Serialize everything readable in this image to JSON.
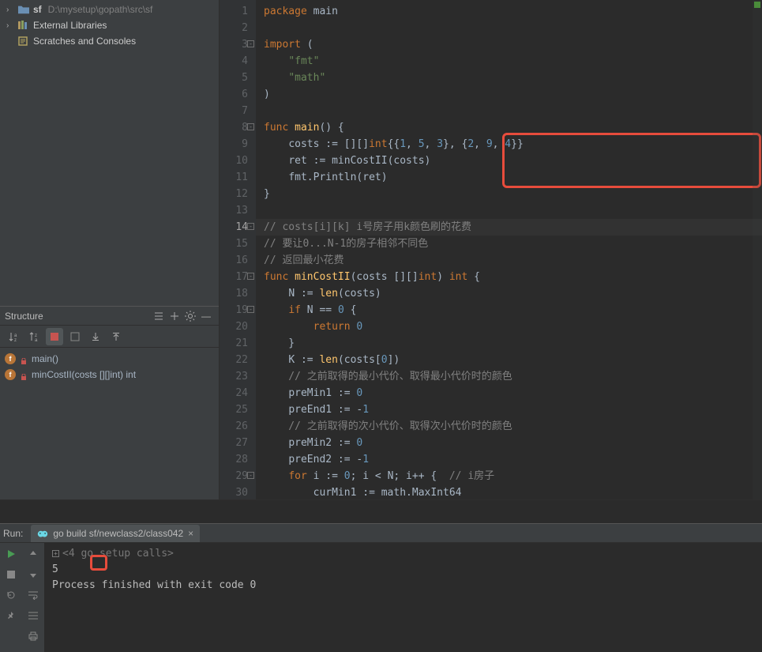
{
  "project": {
    "root_name": "sf",
    "root_path": "D:\\mysetup\\gopath\\src\\sf",
    "external_libs": "External Libraries",
    "scratches": "Scratches and Consoles"
  },
  "structure": {
    "title": "Structure",
    "items": [
      {
        "label": "main()"
      },
      {
        "label": "minCostII(costs [][]int) int"
      }
    ]
  },
  "editor": {
    "current_line": 14,
    "lines": [
      {
        "n": 1,
        "kw": "package ",
        "rest": "main"
      },
      {
        "n": 2,
        "plain": ""
      },
      {
        "n": 3,
        "kw": "import ",
        "rest": "(",
        "fold": "-"
      },
      {
        "n": 4,
        "indent": "    ",
        "str": "\"fmt\""
      },
      {
        "n": 5,
        "indent": "    ",
        "str": "\"math\""
      },
      {
        "n": 6,
        "plain": ")",
        "foldclose": true
      },
      {
        "n": 7,
        "plain": ""
      },
      {
        "n": 8,
        "funcline": true,
        "fold": "-"
      },
      {
        "n": 9,
        "costs": true
      },
      {
        "n": 10,
        "ret": true
      },
      {
        "n": 11,
        "println": true
      },
      {
        "n": 12,
        "plain": "}",
        "foldclose": true
      },
      {
        "n": 13,
        "plain": ""
      },
      {
        "n": 14,
        "cmt": "// costs[i][k] i号房子用k颜色刷的花费",
        "fold": "-"
      },
      {
        "n": 15,
        "cmt": "// 要让0...N-1的房子相邻不同色"
      },
      {
        "n": 16,
        "cmt": "// 返回最小花费",
        "foldclose": true
      },
      {
        "n": 17,
        "mincost_sig": true,
        "fold": "-"
      },
      {
        "n": 18,
        "nlen": true
      },
      {
        "n": 19,
        "ifn": true,
        "fold": "-"
      },
      {
        "n": 20,
        "ret0": true
      },
      {
        "n": 21,
        "plain": "    }",
        "foldclose": true
      },
      {
        "n": 22,
        "klen": true
      },
      {
        "n": 23,
        "cmt": "    // 之前取得的最小代价、取得最小代价时的颜色"
      },
      {
        "n": 24,
        "premin1": true
      },
      {
        "n": 25,
        "preend1": true
      },
      {
        "n": 26,
        "cmt": "    // 之前取得的次小代价、取得次小代价时的颜色"
      },
      {
        "n": 27,
        "premin2": true
      },
      {
        "n": 28,
        "preend2": true
      },
      {
        "n": 29,
        "forloop": true,
        "fold": "-"
      },
      {
        "n": 30,
        "curmin": true
      }
    ]
  },
  "run": {
    "label": "Run:",
    "tab_title": "go build sf/newclass2/class042",
    "setup_calls": "<4 go setup calls>",
    "output": "5",
    "exit_msg": "Process finished with exit code 0"
  },
  "code_tokens": {
    "func": "func",
    "main": "main",
    "costs": "costs",
    "assign": " := ",
    "int2d": "[][]",
    "int_kw": "int",
    "open": "{{",
    "c1": "1",
    "c2": "5",
    "c3": "3",
    "c4": "2",
    "c5": "9",
    "c6": "4",
    "sep": ", ",
    "mid": "}, {",
    "close": "}}",
    "ret": "ret",
    "mincost": "minCostII",
    "fmt": "fmt",
    "println": "Println",
    "N": "N",
    "len": "len",
    "if": "if",
    "eq": " == ",
    "zero": "0",
    "return": "return",
    "K": "K",
    "idx0": "0",
    "premin1": "preMin1",
    "preend1": "preEnd1",
    "neg1": "-1",
    "premin2": "preMin2",
    "preend2": "preEnd2",
    "for": "for",
    "i": "i",
    "lt": " < ",
    "semi": "; ",
    "ipp": "i++",
    "forcmt": " // i房子",
    "curmin1": "curMin1",
    "math": "math",
    "maxint": "MaxInt64",
    "int_type": "int"
  }
}
